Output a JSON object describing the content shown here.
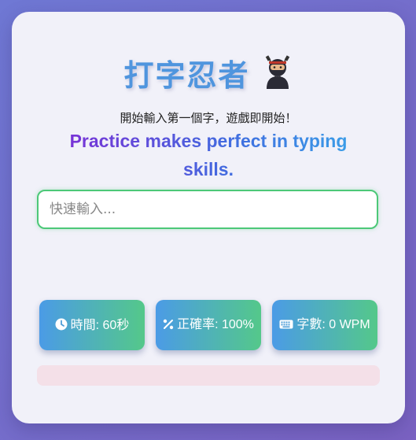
{
  "header": {
    "title": "打字忍者",
    "title_icon": "ninja-emoji"
  },
  "instruction": "開始輸入第一個字，遊戲即開始！",
  "prompt_text": "Practice makes perfect in typing skills.",
  "typing_input": {
    "value": "",
    "placeholder": "快速輸入..."
  },
  "stats": {
    "time": {
      "icon": "clock-icon",
      "label": "時間: 60秒"
    },
    "accuracy": {
      "icon": "percent-icon",
      "label": "正確率: 100%"
    },
    "wpm": {
      "icon": "keyboard-icon",
      "label": "字數: 0 WPM"
    }
  },
  "progress": {
    "fraction": 0
  },
  "colors": {
    "title": "#4f95de",
    "input_border": "#4cc878",
    "stat_gradient_start": "#4b9be6",
    "stat_gradient_end": "#54c88a",
    "progress_track": "#f4e0e8"
  }
}
